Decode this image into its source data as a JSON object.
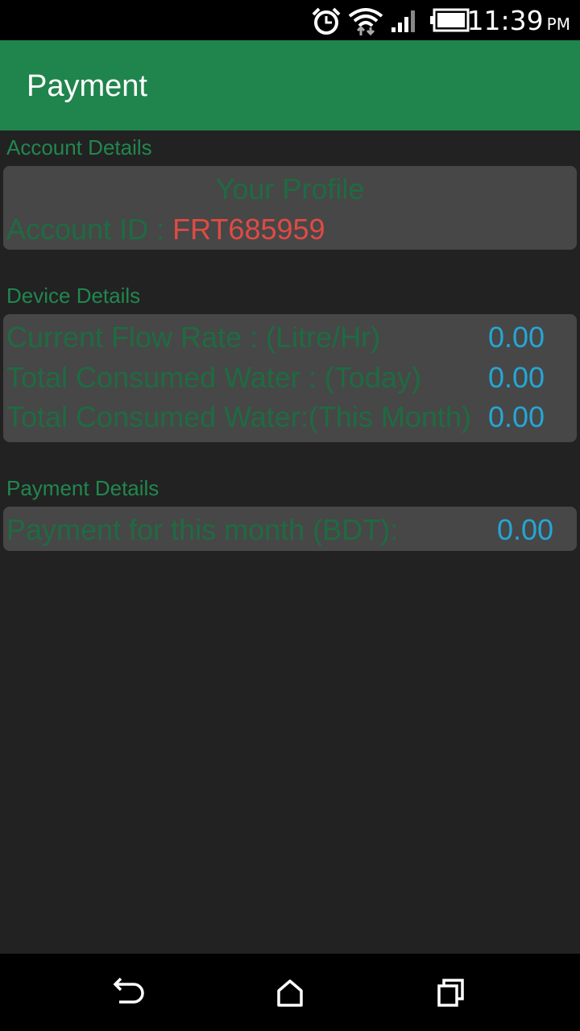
{
  "status_bar": {
    "time": "11:39",
    "ampm": "PM",
    "icons": [
      "alarm-icon",
      "wifi-icon",
      "signal-icon",
      "battery-icon"
    ]
  },
  "app_bar": {
    "title": "Payment"
  },
  "account": {
    "section_label": "Account Details",
    "card_title": "Your Profile",
    "account_id_label": "Account ID : ",
    "account_id_value": "FRT685959"
  },
  "device": {
    "section_label": "Device Details",
    "rows": [
      {
        "label": "Current Flow Rate : (Litre/Hr)",
        "value": "0.00"
      },
      {
        "label": "Total Consumed Water : (Today)",
        "value": "0.00"
      },
      {
        "label": "Total Consumed Water:(This Month)",
        "value": "0.00"
      }
    ]
  },
  "payment": {
    "section_label": "Payment Details",
    "row": {
      "label": "Payment for this month (BDT):",
      "value": "0.00"
    }
  },
  "nav_bar": {
    "icons": [
      "back-icon",
      "home-icon",
      "recents-icon"
    ]
  },
  "colors": {
    "accent": "#20844d",
    "label_green": "#1e6b42",
    "value_blue": "#25a6d4",
    "id_red": "#df4b44",
    "background": "#222222",
    "card": "#474747"
  }
}
